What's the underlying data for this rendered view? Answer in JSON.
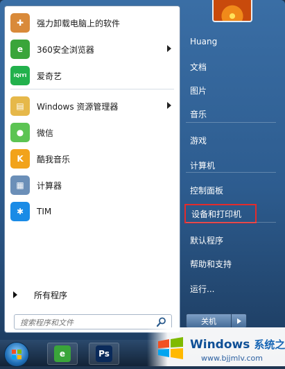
{
  "pinned_apps": [
    {
      "label": "强力卸载电脑上的软件",
      "icon": "uninstall-box-icon",
      "color": "#d98a3a",
      "glyph": "✚",
      "has_arrow": false
    },
    {
      "label": "360安全浏览器",
      "icon": "browser-360-icon",
      "color": "#3aa53a",
      "glyph": "e",
      "has_arrow": true
    },
    {
      "label": "爱奇艺",
      "icon": "iqiyi-icon",
      "color": "#22b14c",
      "glyph": "iQIYI",
      "has_arrow": false
    }
  ],
  "recent_apps": [
    {
      "label": "Windows 资源管理器",
      "icon": "folder-icon",
      "color": "#e6b84a",
      "glyph": "▤",
      "has_arrow": true
    },
    {
      "label": "微信",
      "icon": "wechat-icon",
      "color": "#5cc453",
      "glyph": "●",
      "has_arrow": false
    },
    {
      "label": "酷我音乐",
      "icon": "kuwo-music-icon",
      "color": "#f2a31b",
      "glyph": "K",
      "has_arrow": false
    },
    {
      "label": "计算器",
      "icon": "calculator-icon",
      "color": "#6b8fb8",
      "glyph": "▦",
      "has_arrow": false
    },
    {
      "label": "TIM",
      "icon": "tim-icon",
      "color": "#1a8be6",
      "glyph": "✱",
      "has_arrow": false
    }
  ],
  "all_programs_label": "所有程序",
  "search": {
    "placeholder": "搜索程序和文件"
  },
  "right_panel": {
    "items": [
      {
        "label": "Huang",
        "name": "user-folder-link"
      },
      {
        "label": "文档",
        "name": "documents-link"
      },
      {
        "label": "图片",
        "name": "pictures-link"
      },
      {
        "label": "音乐",
        "name": "music-link"
      },
      {
        "label": "游戏",
        "name": "games-link"
      },
      {
        "label": "计算机",
        "name": "computer-link"
      },
      {
        "label": "控制面板",
        "name": "control-panel-link"
      },
      {
        "label": "设备和打印机",
        "name": "devices-printers-link",
        "highlighted": true
      },
      {
        "label": "默认程序",
        "name": "default-programs-link"
      },
      {
        "label": "帮助和支持",
        "name": "help-support-link"
      },
      {
        "label": "运行...",
        "name": "run-link"
      }
    ],
    "highlight_color": "#e52b2b"
  },
  "shutdown": {
    "label": "关机"
  },
  "taskbar": {
    "items": [
      {
        "icon": "browser-360-icon",
        "color": "#3aa53a",
        "glyph": "e"
      },
      {
        "icon": "photoshop-icon",
        "color": "#0a2a5a",
        "glyph": "Ps"
      }
    ]
  },
  "watermark": {
    "title": "Windows",
    "subtitle": "系统之家",
    "url": "www.bjjmlv.com"
  }
}
